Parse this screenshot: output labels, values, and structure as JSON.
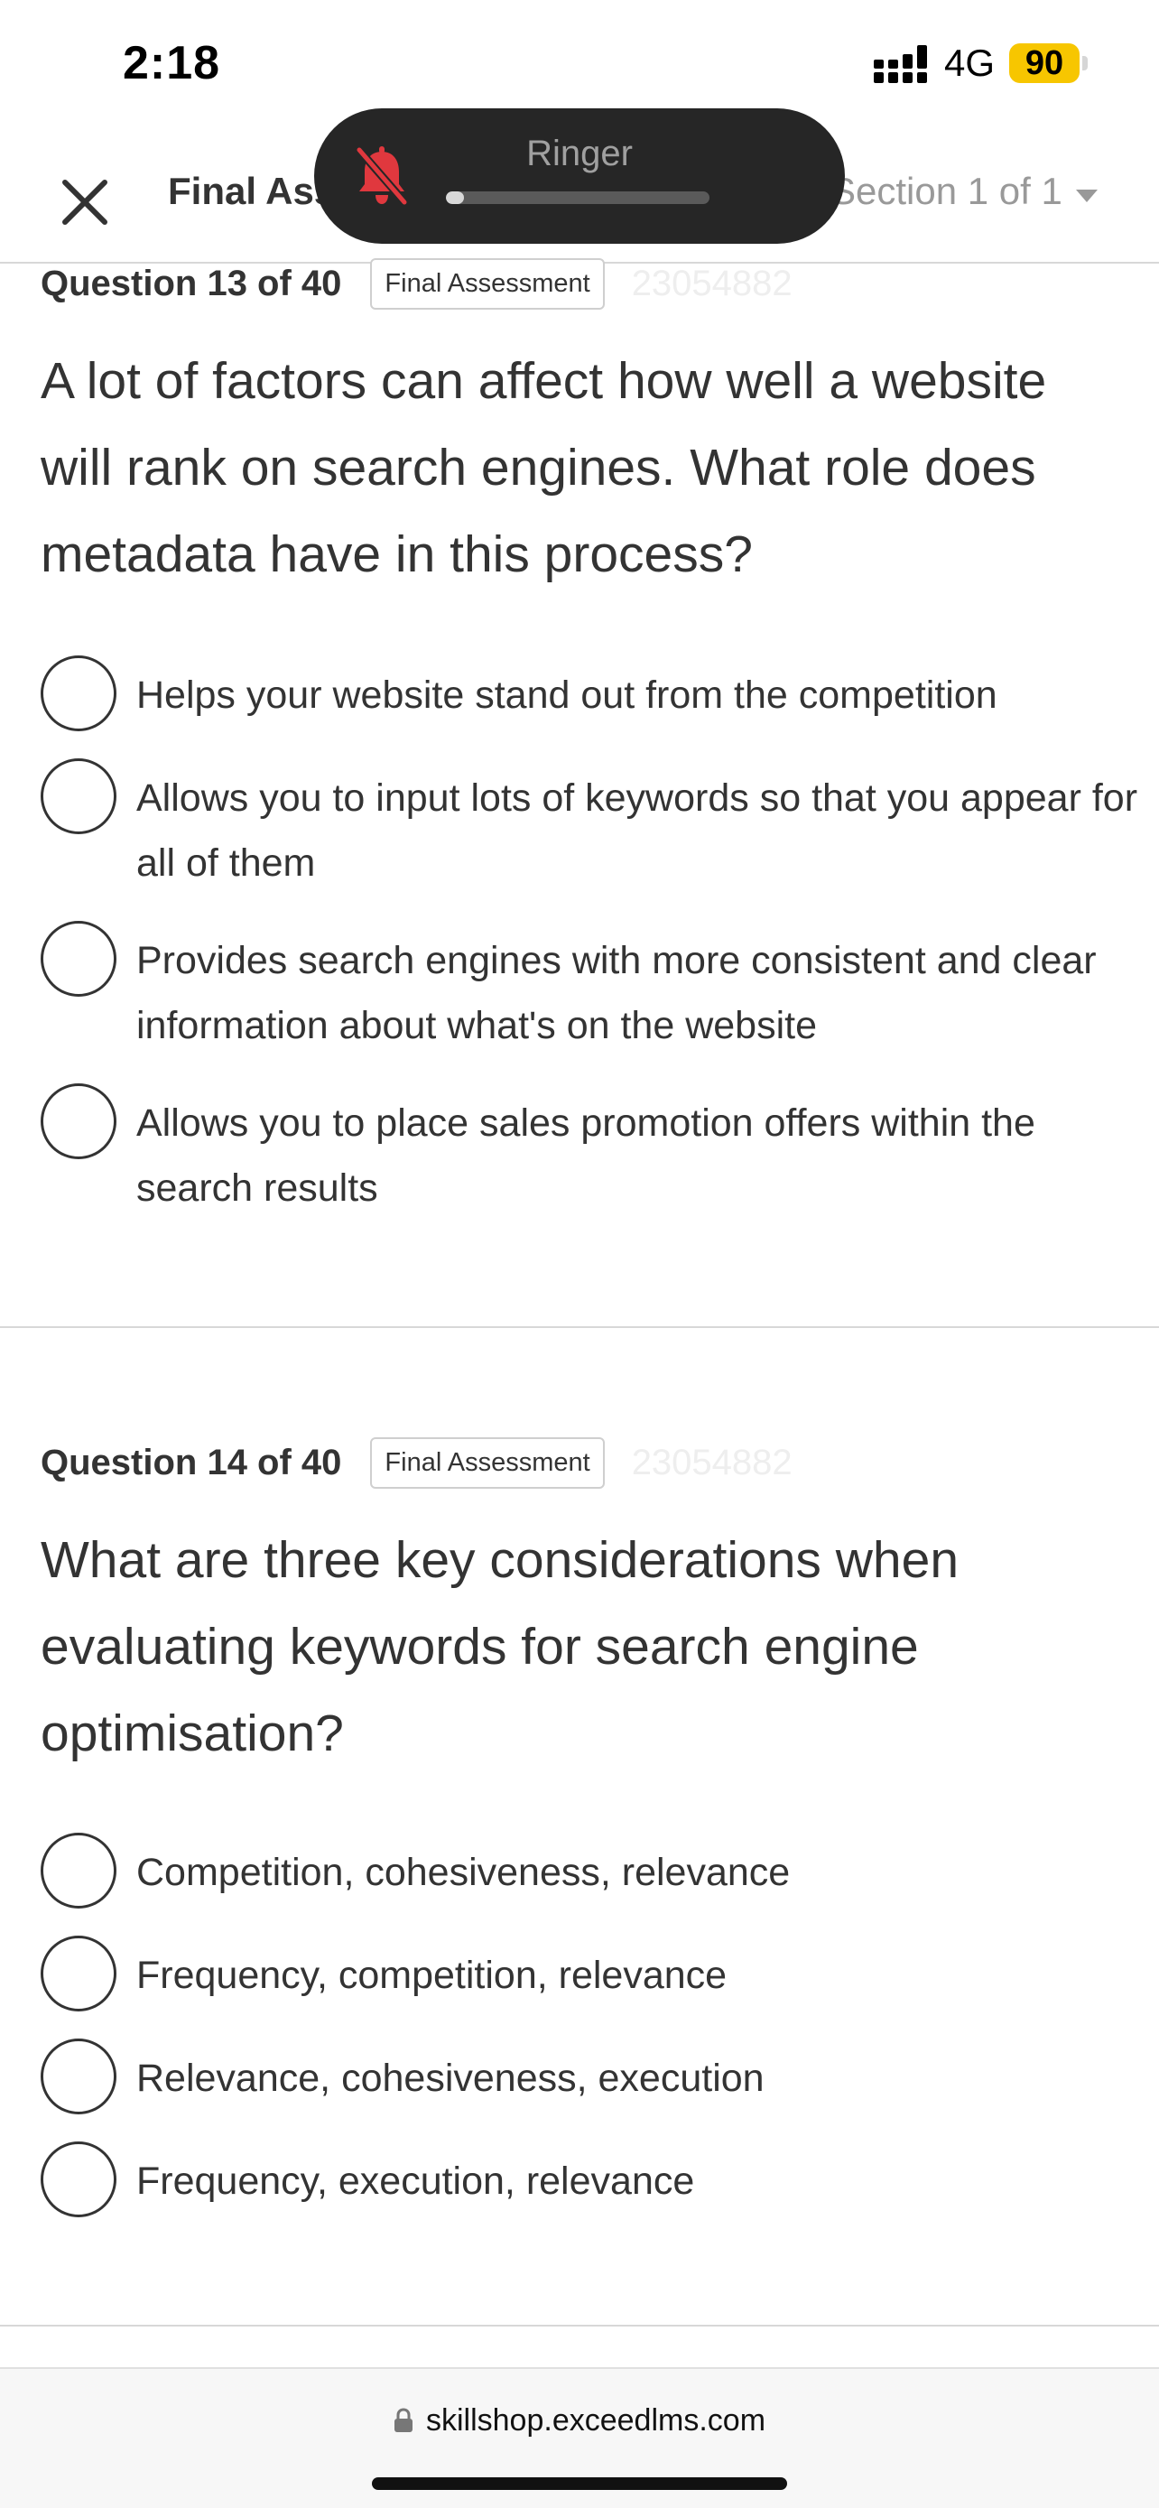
{
  "status_bar": {
    "time": "2:18",
    "network": "4G",
    "battery": "90",
    "battery_color": "#f7c600"
  },
  "header": {
    "title": "Final Assessment",
    "section": "Section 1 of 1",
    "close_icon": "close-icon",
    "dropdown_icon": "chevron-down-icon"
  },
  "ringer": {
    "label": "Ringer",
    "icon": "bell-slash-icon",
    "icon_color": "#e0383e",
    "level": 0.07
  },
  "questions": [
    {
      "number": "Question 13 of 40",
      "tag": "Final Assessment",
      "id": "23054882",
      "text": "A lot of factors can affect how well a website will rank on search engines. What role does metadata have in this process?",
      "options": [
        "Helps your website stand out from the competition",
        "Allows you to input lots of keywords so that you appear for all of them",
        "Provides search engines with more consistent and clear information about what's on the website",
        "Allows you to place sales promotion offers within the search results"
      ]
    },
    {
      "number": "Question 14 of 40",
      "tag": "Final Assessment",
      "id": "23054882",
      "text": "What are three key considerations when evaluating keywords for search engine optimisation?",
      "options": [
        "Competition, cohesiveness, relevance",
        "Frequency, competition, relevance",
        "Relevance, cohesiveness, execution",
        "Frequency, execution, relevance"
      ]
    }
  ],
  "browser": {
    "url": "skillshop.exceedlms.com",
    "lock_icon": "lock-icon"
  }
}
